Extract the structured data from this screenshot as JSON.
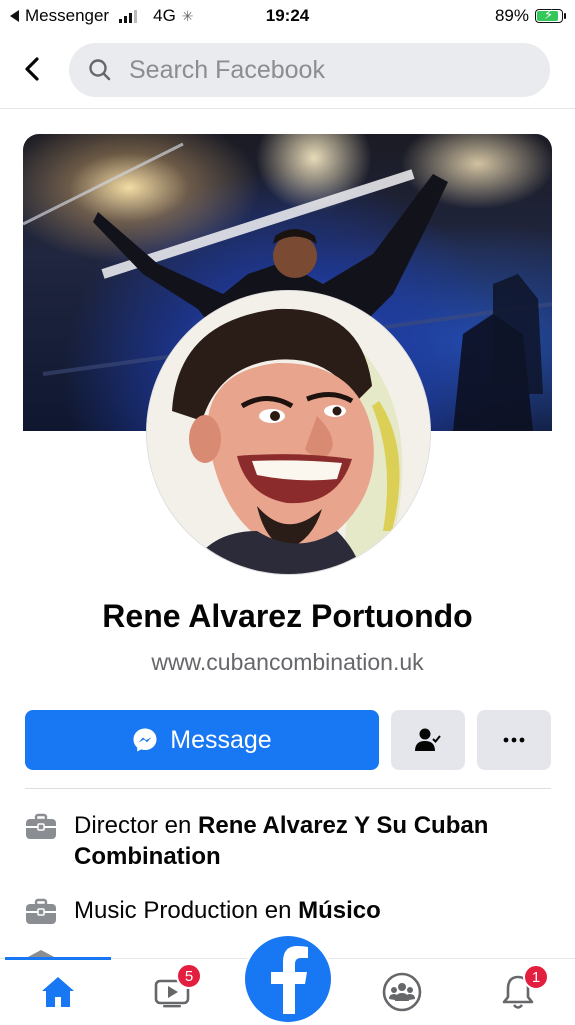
{
  "status_bar": {
    "back_app": "Messenger",
    "network": "4G",
    "time": "19:24",
    "battery": "89%",
    "battery_level": 0.89
  },
  "search": {
    "placeholder": "Search Facebook"
  },
  "profile": {
    "name": "Rene Alvarez Portuondo",
    "website": "www.cubancombination.uk"
  },
  "actions": {
    "message_label": "Message"
  },
  "info": [
    {
      "prefix": "Director en ",
      "bold": "Rene Alvarez Y Su Cuban Combination"
    },
    {
      "prefix": "Music Production en ",
      "bold": "Músico"
    }
  ],
  "tabs": {
    "watch_badge": "5",
    "notifications_badge": "1"
  },
  "colors": {
    "accent": "#1877f2",
    "badge": "#e41e3f",
    "button_gray": "#e4e6eb"
  }
}
